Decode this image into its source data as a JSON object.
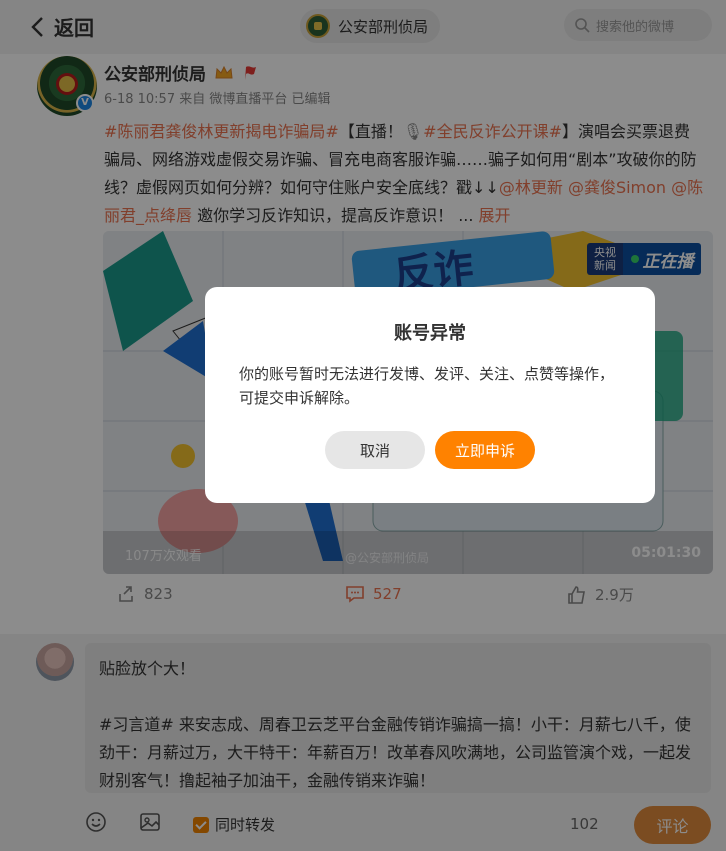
{
  "header": {
    "back_label": "返回",
    "account_name": "公安部刑侦局",
    "search_placeholder": "搜索他的微博"
  },
  "post": {
    "author": "公安部刑侦局",
    "time": "6-18 10:57",
    "source": "来自 微博直播平台",
    "edited": "已编辑",
    "text_parts": {
      "topic1": "#陈丽君龚俊林更新揭电诈骗局#",
      "t1": "【直播！",
      "topic2": "#全民反诈公开课#",
      "t2": "】演唱会买票退费骗局、网络游戏虚假交易诈骗、冒充电商客服诈骗……骗子如何用“剧本”攻破你的防线？虚假网页如何分辨？如何守住账户安全底线？戳↓↓",
      "mention1": "@林更新",
      "mention2": "@龚俊Simon",
      "mention3": "@陈丽君_点绛唇",
      "t3": " 邀你学习反诈知识，提高反诈意识！ ... ",
      "expand": "展开"
    },
    "media": {
      "views": "107万次观看",
      "watermark": "@公安部刑侦局",
      "duration": "05:01:30",
      "live_badge_left": "央视新闻",
      "live_badge_right": "正在播",
      "banner_text": "反诈"
    },
    "stats": {
      "reposts": "823",
      "comments": "527",
      "likes": "2.9万"
    }
  },
  "composer": {
    "text": "贴脸放个大！\n\n#习言道# 来安志成、周春卫云芝平台金融传销诈骗搞一搞！小干：月薪七八千，使劲干：月薪过万，大干特干：年薪百万！改革春风吹满地，公司监管演个戏，一起发财别客气！撸起袖子加油干，金融传销来诈骗！",
    "sync_label": "同时转发",
    "char_count": "102",
    "submit_label": "评论"
  },
  "dialog": {
    "title": "账号异常",
    "message": "你的账号暂时无法进行发博、发评、关注、点赞等操作，可提交申诉解除。",
    "cancel_label": "取消",
    "appeal_label": "立即申诉"
  },
  "colors": {
    "accent": "#ff8200",
    "link": "#eb7350",
    "overlay": "rgba(0,0,0,0.45)"
  }
}
